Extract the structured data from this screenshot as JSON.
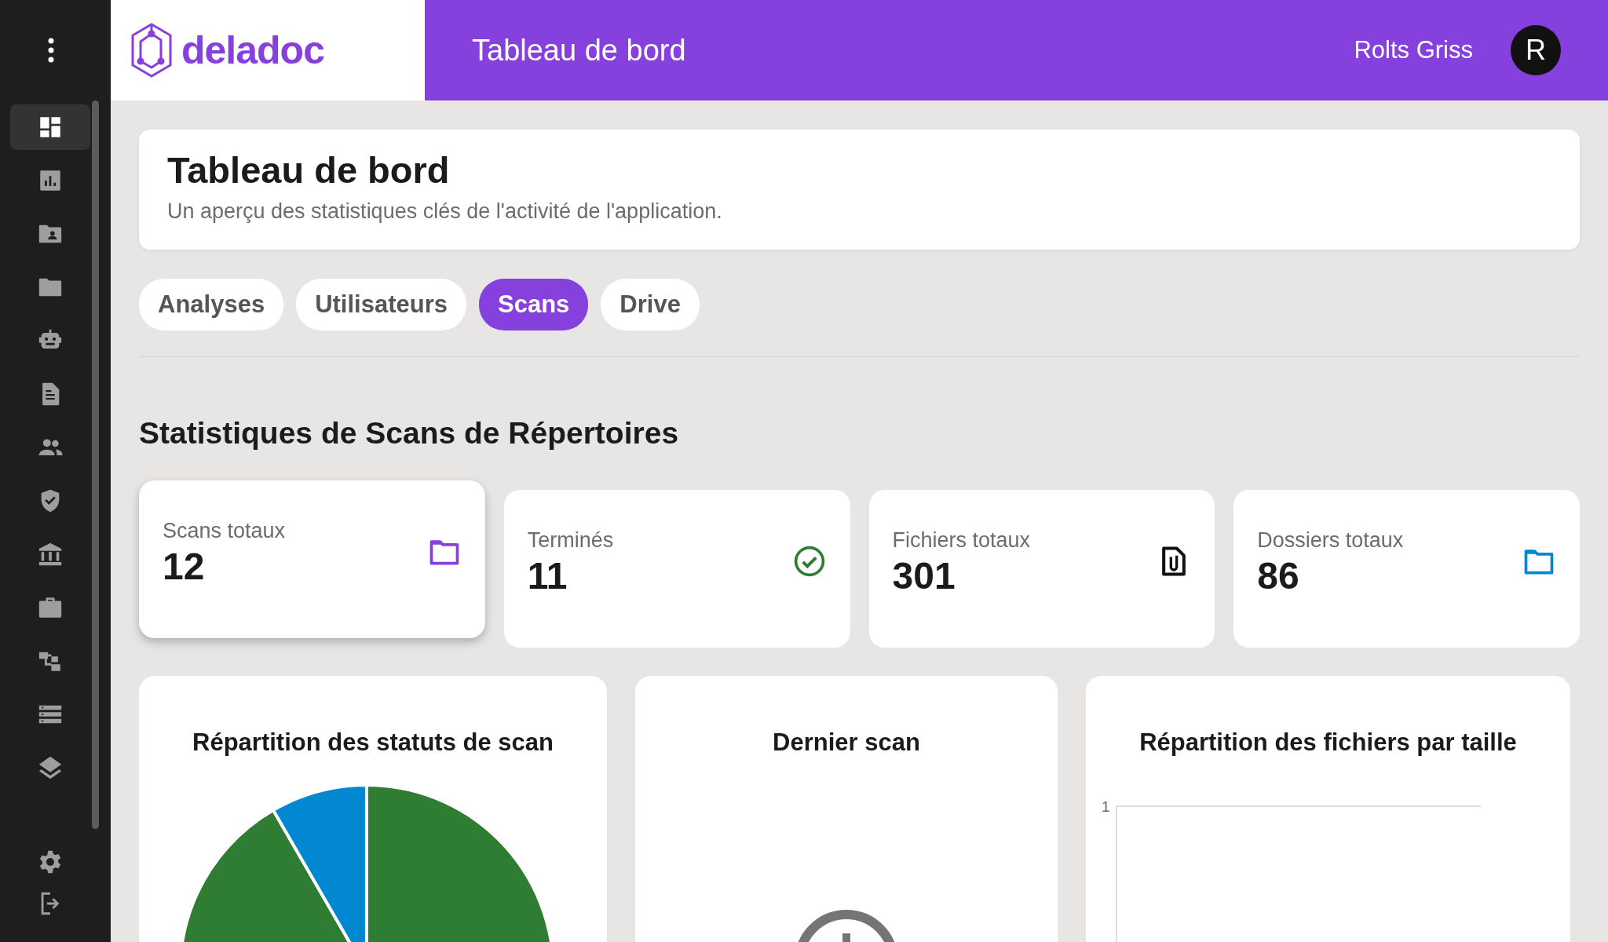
{
  "sidebar": {
    "items": [
      {
        "kind": "dashboard",
        "selected": true
      },
      {
        "kind": "chart",
        "selected": false
      },
      {
        "kind": "contact-folder",
        "selected": false
      },
      {
        "kind": "folder",
        "selected": false
      },
      {
        "kind": "robot",
        "selected": false
      },
      {
        "kind": "document",
        "selected": false
      },
      {
        "kind": "people",
        "selected": false
      },
      {
        "kind": "shield",
        "selected": false
      },
      {
        "kind": "bank",
        "selected": false
      },
      {
        "kind": "briefcase",
        "selected": false
      },
      {
        "kind": "hierarchy",
        "selected": false
      },
      {
        "kind": "list",
        "selected": false
      },
      {
        "kind": "layers",
        "selected": false
      }
    ],
    "bottom_items": [
      {
        "kind": "settings",
        "selected": false
      },
      {
        "kind": "logout",
        "selected": false
      }
    ]
  },
  "logo": {
    "text": "deladoc"
  },
  "header": {
    "title": "Tableau de bord",
    "user_name": "Rolts Griss",
    "avatar_initial": "R"
  },
  "page_header": {
    "title": "Tableau de bord",
    "subtitle": "Un aperçu des statistiques clés de l'activité de l'application."
  },
  "tabs": [
    {
      "label": "Analyses",
      "selected": false
    },
    {
      "label": "Utilisateurs",
      "selected": false
    },
    {
      "label": "Scans",
      "selected": true
    },
    {
      "label": "Drive",
      "selected": false
    }
  ],
  "section_title": "Statistiques de Scans de Répertoires",
  "stats": [
    {
      "label": "Scans totaux",
      "value": "12",
      "kind": "folder",
      "color": "#8540dd",
      "selected": true
    },
    {
      "label": "Terminés",
      "value": "11",
      "kind": "check",
      "color": "#2e7d32",
      "selected": false
    },
    {
      "label": "Fichiers totaux",
      "value": "301",
      "kind": "attachment",
      "color": "#111111",
      "selected": false
    },
    {
      "label": "Dossiers totaux",
      "value": "86",
      "kind": "folder",
      "color": "#0288d1",
      "selected": false
    }
  ],
  "panels": [
    {
      "title": "Répartition des statuts de scan",
      "kind": "pie"
    },
    {
      "title": "Dernier scan",
      "kind": "latest"
    },
    {
      "title": "Répartition des fichiers par taille",
      "kind": "bar",
      "y_tick": "1"
    }
  ]
}
